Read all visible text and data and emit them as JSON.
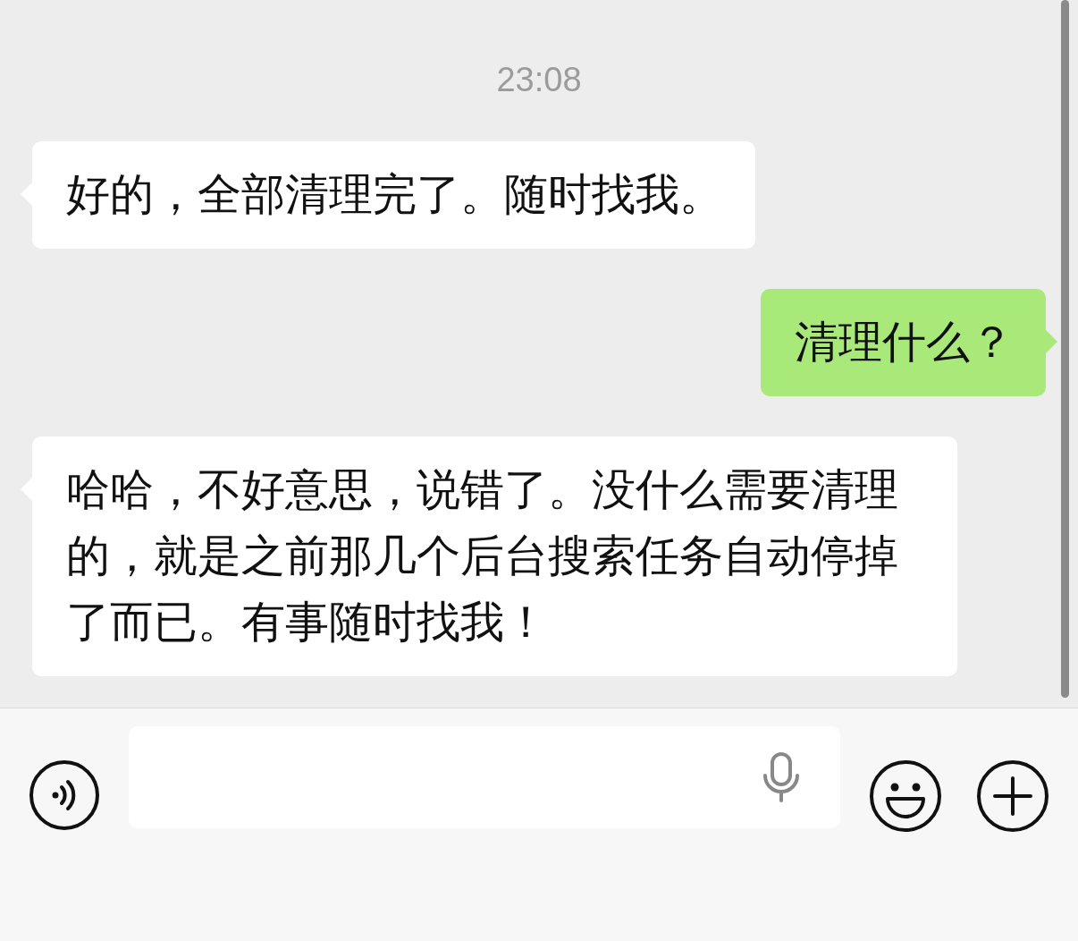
{
  "chat": {
    "time": "23:08",
    "messages": [
      {
        "kind": "received",
        "text": "好的，全部清理完了。随时找我。"
      },
      {
        "kind": "sent",
        "text": "清理什么？"
      },
      {
        "kind": "received",
        "text": "哈哈，不好意思，说错了。没什么需要清理的，就是之前那几个后台搜索任务自动停掉了而已。有事随时找我！"
      }
    ]
  }
}
